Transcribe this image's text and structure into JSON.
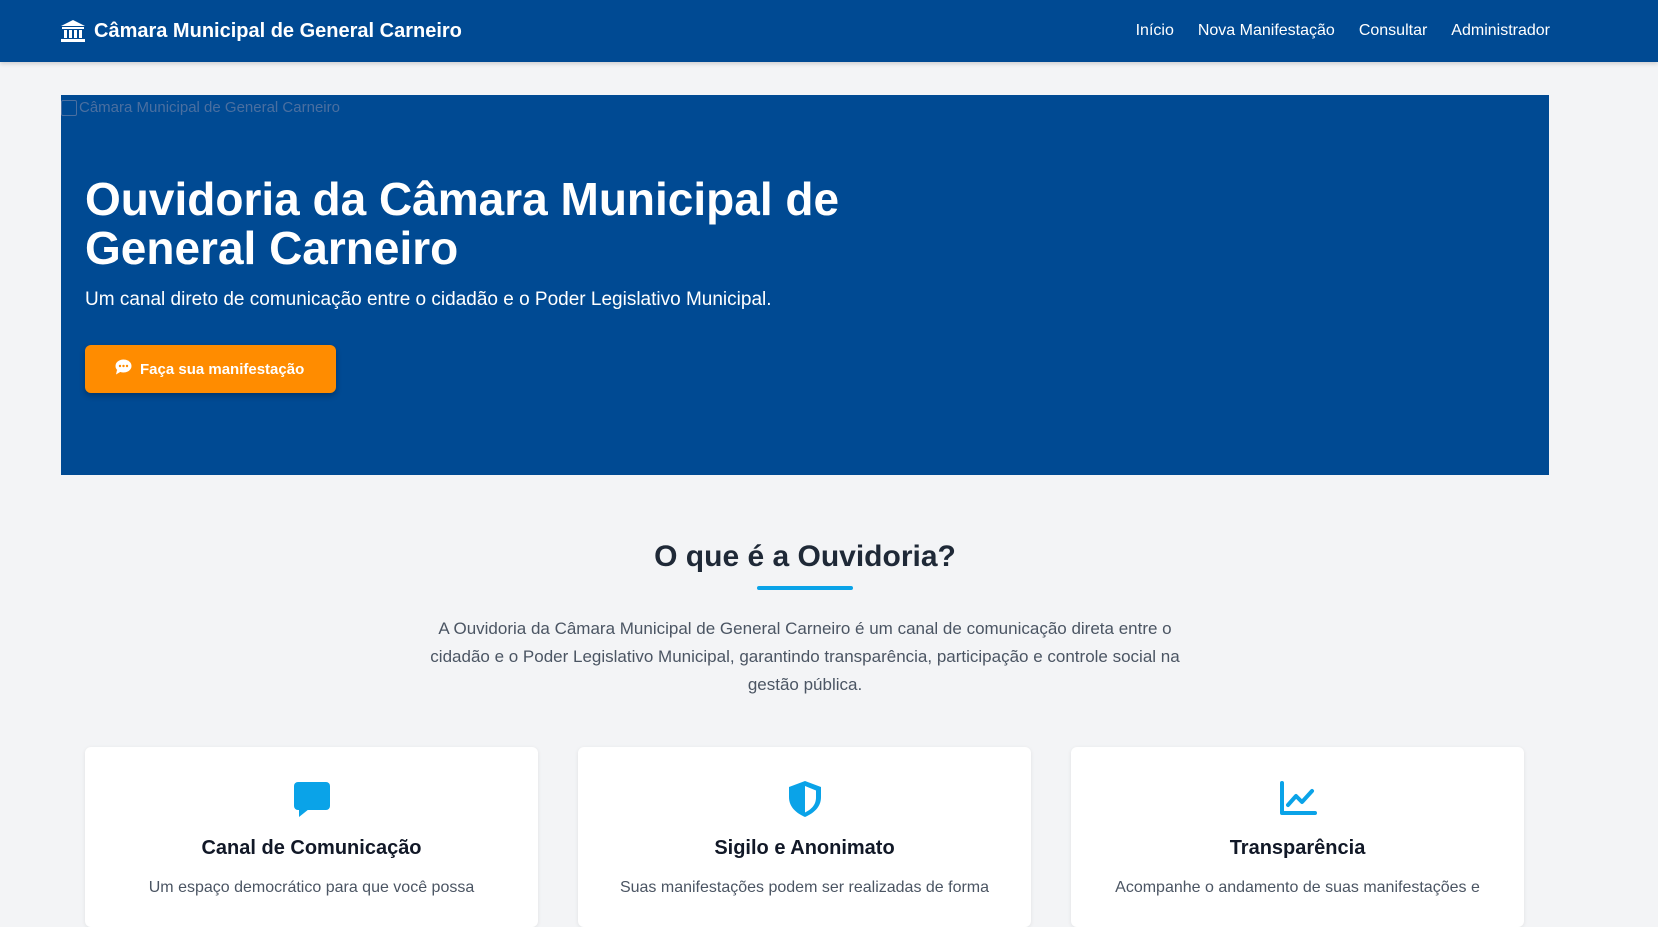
{
  "navbar": {
    "brand": "Câmara Municipal de General Carneiro",
    "links": [
      "Início",
      "Nova Manifestação",
      "Consultar",
      "Administrador"
    ]
  },
  "hero": {
    "image_alt": "Câmara Municipal de General Carneiro",
    "title": "Ouvidoria da Câmara Municipal de General Carneiro",
    "subtitle": "Um canal direto de comunicação entre o cidadão e o Poder Legislativo Municipal.",
    "cta_label": "Faça sua manifestação"
  },
  "about": {
    "title": "O que é a Ouvidoria?",
    "text": "A Ouvidoria da Câmara Municipal de General Carneiro é um canal de comunicação direta entre o cidadão e o Poder Legislativo Municipal, garantindo transparência, participação e controle social na gestão pública."
  },
  "cards": [
    {
      "icon": "comment-icon",
      "title": "Canal de Comunicação",
      "description": "Um espaço democrático para que você possa"
    },
    {
      "icon": "shield-icon",
      "title": "Sigilo e Anonimato",
      "description": "Suas manifestações podem ser realizadas de forma"
    },
    {
      "icon": "chart-line-icon",
      "title": "Transparência",
      "description": "Acompanhe o andamento de suas manifestações e"
    }
  ],
  "colors": {
    "primary": "#004a93",
    "accent": "#ff8c00",
    "highlight": "#0aa3e8",
    "background": "#f3f4f6"
  }
}
